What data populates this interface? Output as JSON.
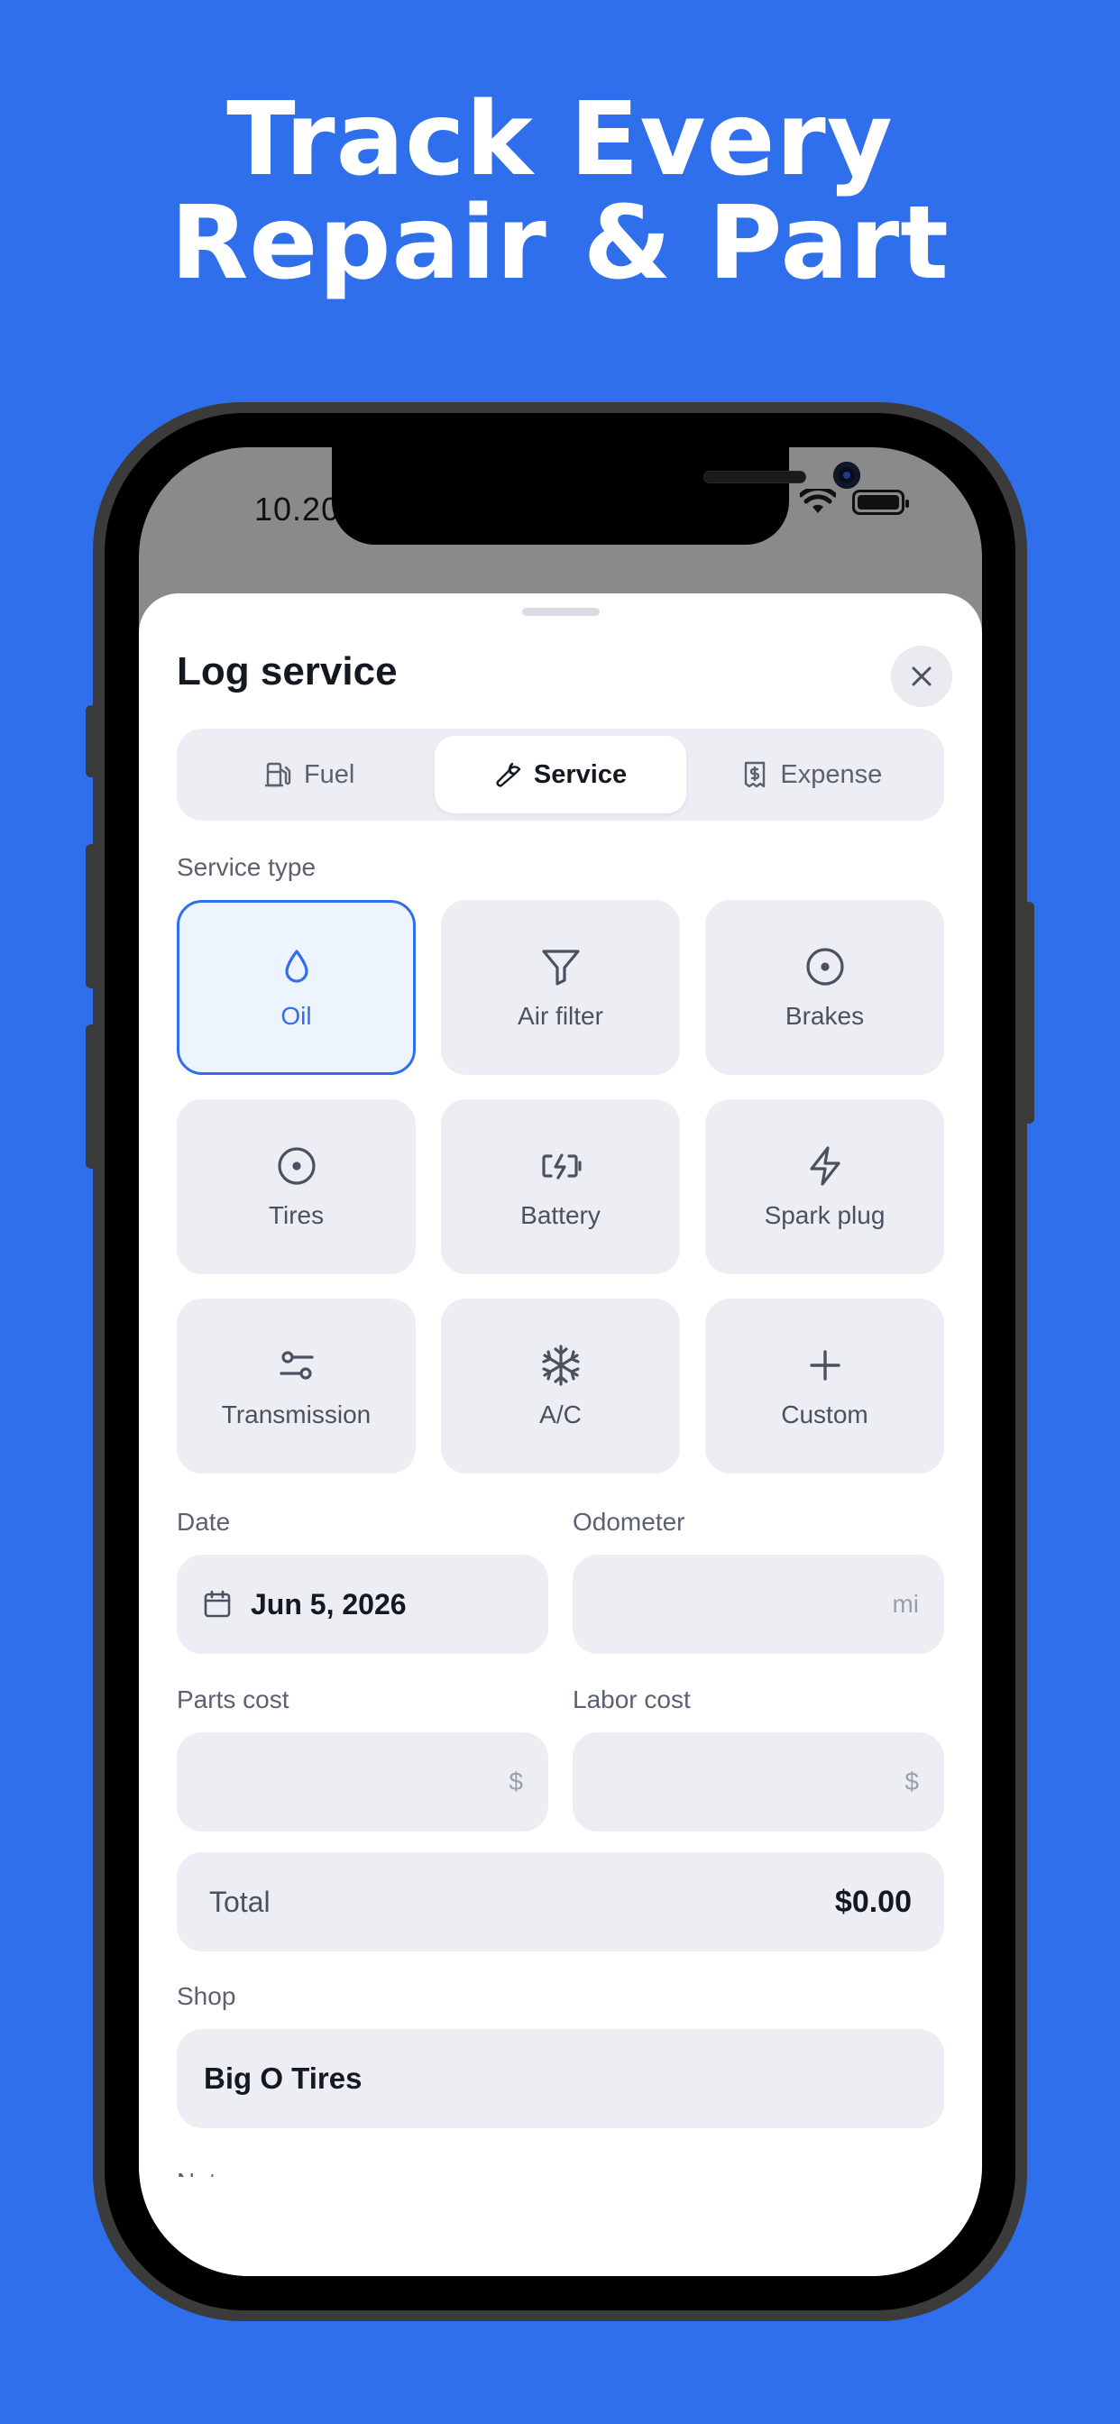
{
  "headline": {
    "line1": "Track Every",
    "line2": "Repair & Part"
  },
  "status_bar": {
    "time": "10.20"
  },
  "sheet": {
    "title": "Log service",
    "tabs": [
      {
        "label": "Fuel",
        "icon": "fuel-pump-icon",
        "active": false
      },
      {
        "label": "Service",
        "icon": "wrench-icon",
        "active": true
      },
      {
        "label": "Expense",
        "icon": "receipt-dollar-icon",
        "active": false
      }
    ],
    "service_type_label": "Service type",
    "service_types": [
      {
        "label": "Oil",
        "icon": "oil-drop-icon",
        "selected": true
      },
      {
        "label": "Air filter",
        "icon": "filter-icon",
        "selected": false
      },
      {
        "label": "Brakes",
        "icon": "brake-disc-icon",
        "selected": false
      },
      {
        "label": "Tires",
        "icon": "tire-icon",
        "selected": false
      },
      {
        "label": "Battery",
        "icon": "battery-charging-icon",
        "selected": false
      },
      {
        "label": "Spark plug",
        "icon": "lightning-icon",
        "selected": false
      },
      {
        "label": "Transmission",
        "icon": "sliders-icon",
        "selected": false
      },
      {
        "label": "A/C",
        "icon": "snowflake-icon",
        "selected": false
      },
      {
        "label": "Custom",
        "icon": "plus-icon",
        "selected": false
      }
    ],
    "date": {
      "label": "Date",
      "value": "Jun 5, 2026"
    },
    "odometer": {
      "label": "Odometer",
      "value": "",
      "unit": "mi"
    },
    "parts_cost": {
      "label": "Parts cost",
      "value": "",
      "unit": "$"
    },
    "labor_cost": {
      "label": "Labor cost",
      "value": "",
      "unit": "$"
    },
    "total": {
      "label": "Total",
      "value": "$0.00"
    },
    "shop": {
      "label": "Shop",
      "value": "Big O Tires"
    },
    "notes": {
      "label": "Notes"
    }
  },
  "colors": {
    "brand": "#2F6FEB",
    "field_bg": "#ECEEF4",
    "text_dark": "#141821"
  }
}
